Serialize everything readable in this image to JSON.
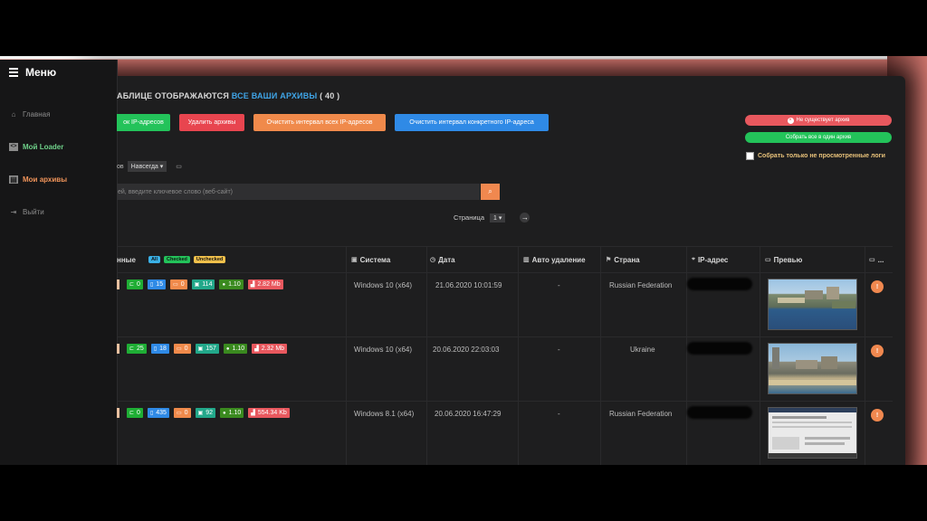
{
  "sidebar": {
    "title": "Меню",
    "items": [
      {
        "label": "Главная",
        "icon": "home-icon"
      },
      {
        "label": "Мой Loader",
        "icon": "code-icon"
      },
      {
        "label": "Мои архивы",
        "icon": "archive-icon"
      },
      {
        "label": "Выйти",
        "icon": "logout-icon"
      }
    ]
  },
  "header": {
    "title_prefix": "АБЛИЦЕ ОТОБРАЖАЮТСЯ",
    "title_highlight": "ВСЕ ВАШИ АРХИВЫ",
    "title_count": "( 40 )"
  },
  "toolbar": {
    "buttons": [
      {
        "label": "ок IP-адресов",
        "color": "#23c35a"
      },
      {
        "label": "Удалить архивы",
        "color": "#e8454f"
      },
      {
        "label": "Очистить интервал всех IP-адресов",
        "color": "#f08a4b"
      },
      {
        "label": "Очистить интервал конкретного IP-адреса",
        "color": "#2f8ae6"
      }
    ]
  },
  "right_actions": {
    "not_exists": "Не существует архив",
    "collect_all": "Собрать все в один архив",
    "checkbox_label": "Собрать только не просмотренные логи"
  },
  "filters": {
    "period_label": "ов",
    "period_value": "Навсегда",
    "search_placeholder": "ей, введите ключевое слово (веб-сайт)"
  },
  "pager": {
    "label": "Страница",
    "value": "1"
  },
  "table": {
    "columns": {
      "data": "нные",
      "tag_all": "All",
      "tag_checked": "Checked",
      "tag_unchecked": "Unchecked",
      "system": "Система",
      "date": "Дата",
      "auto_delete": "Авто удаление",
      "country": "Страна",
      "ip": "IP-адрес",
      "preview": "Превью",
      "more": "..."
    },
    "rows": [
      {
        "passwords": "0",
        "cookies": "15",
        "cards": "0",
        "autofill": "114",
        "version": "1.10",
        "size": "2.82 Mb",
        "system": "Windows 10 (x64)",
        "date": "21.06.2020 10:01:59",
        "auto_delete": "-",
        "country": "Russian Federation"
      },
      {
        "passwords": "25",
        "cookies": "18",
        "cards": "0",
        "autofill": "157",
        "version": "1.10",
        "size": "2.32 Mb",
        "system": "Windows 10 (x64)",
        "date": "20.06.2020 22:03:03",
        "auto_delete": "-",
        "country": "Ukraine"
      },
      {
        "passwords": "0",
        "cookies": "435",
        "cards": "0",
        "autofill": "92",
        "version": "1.10",
        "size": "554.34 Kb",
        "system": "Windows 8.1 (x64)",
        "date": "20.06.2020 16:47:29",
        "auto_delete": "-",
        "country": "Russian Federation"
      }
    ],
    "action_label": "!"
  }
}
